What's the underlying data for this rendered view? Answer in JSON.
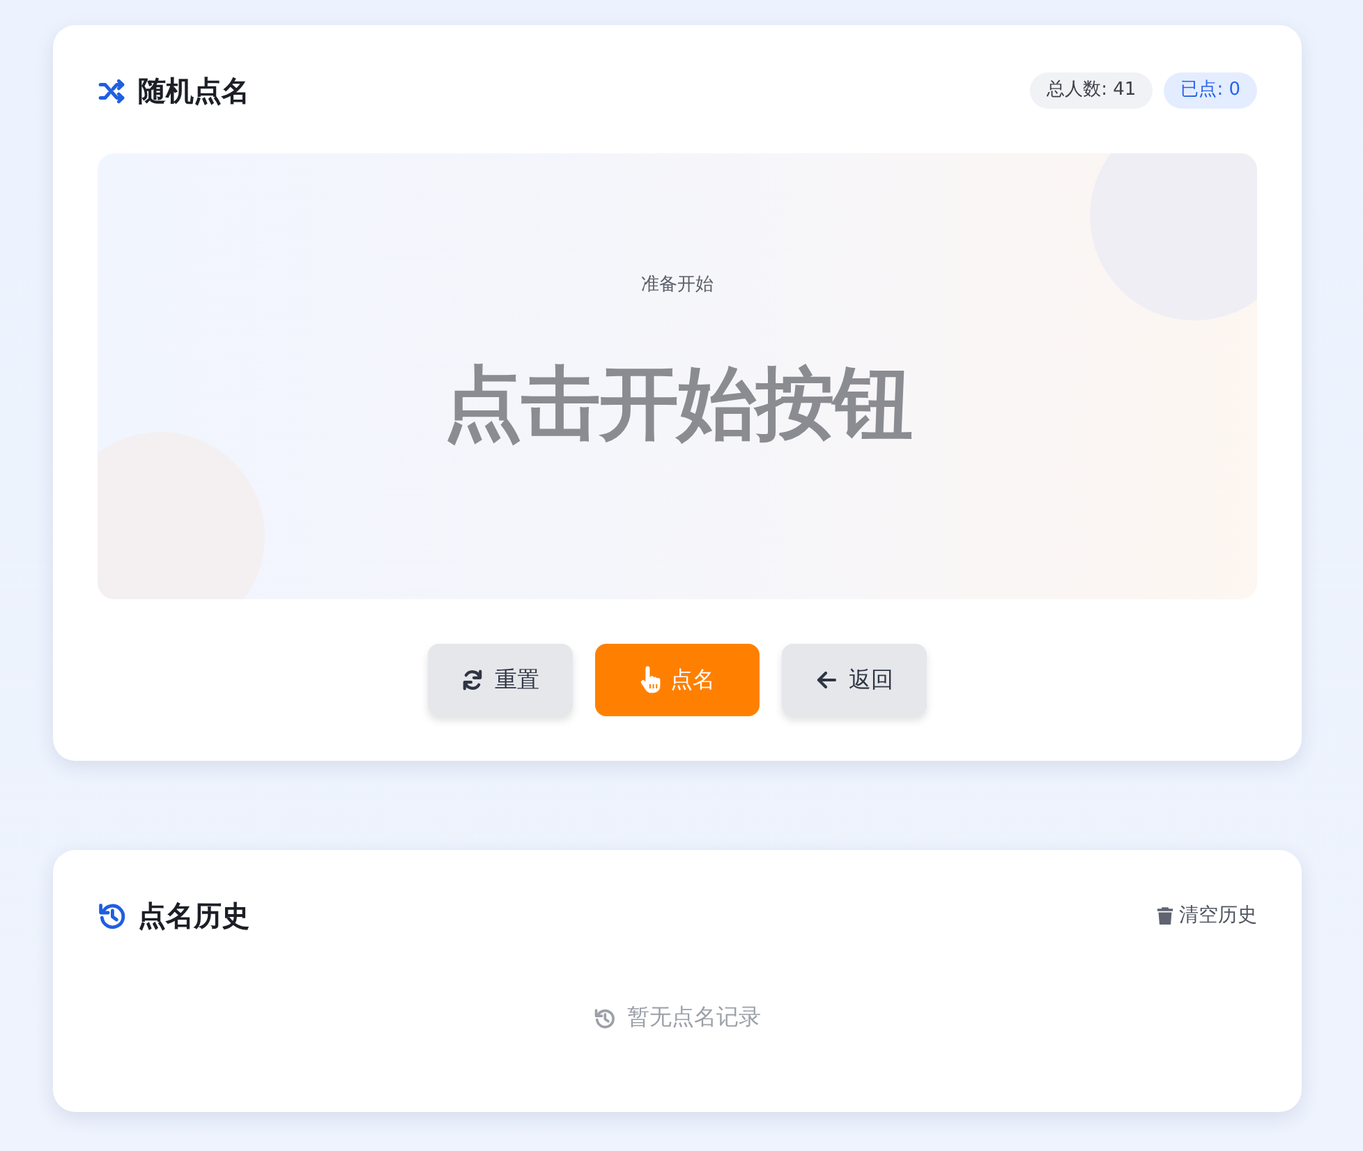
{
  "roll_call": {
    "title": "随机点名",
    "badges": [
      {
        "kind": "total",
        "label": "总人数: 41"
      },
      {
        "kind": "picked",
        "label": "已点: 0"
      }
    ],
    "stage": {
      "status": "准备开始",
      "name": "点击开始按钮"
    },
    "buttons": [
      {
        "kind": "reset",
        "label": "重置"
      },
      {
        "kind": "pick",
        "label": "点名"
      },
      {
        "kind": "back",
        "label": "返回"
      }
    ]
  },
  "history": {
    "title": "点名历史",
    "clear_label": "清空历史",
    "empty_text": "暂无点名记录"
  }
}
